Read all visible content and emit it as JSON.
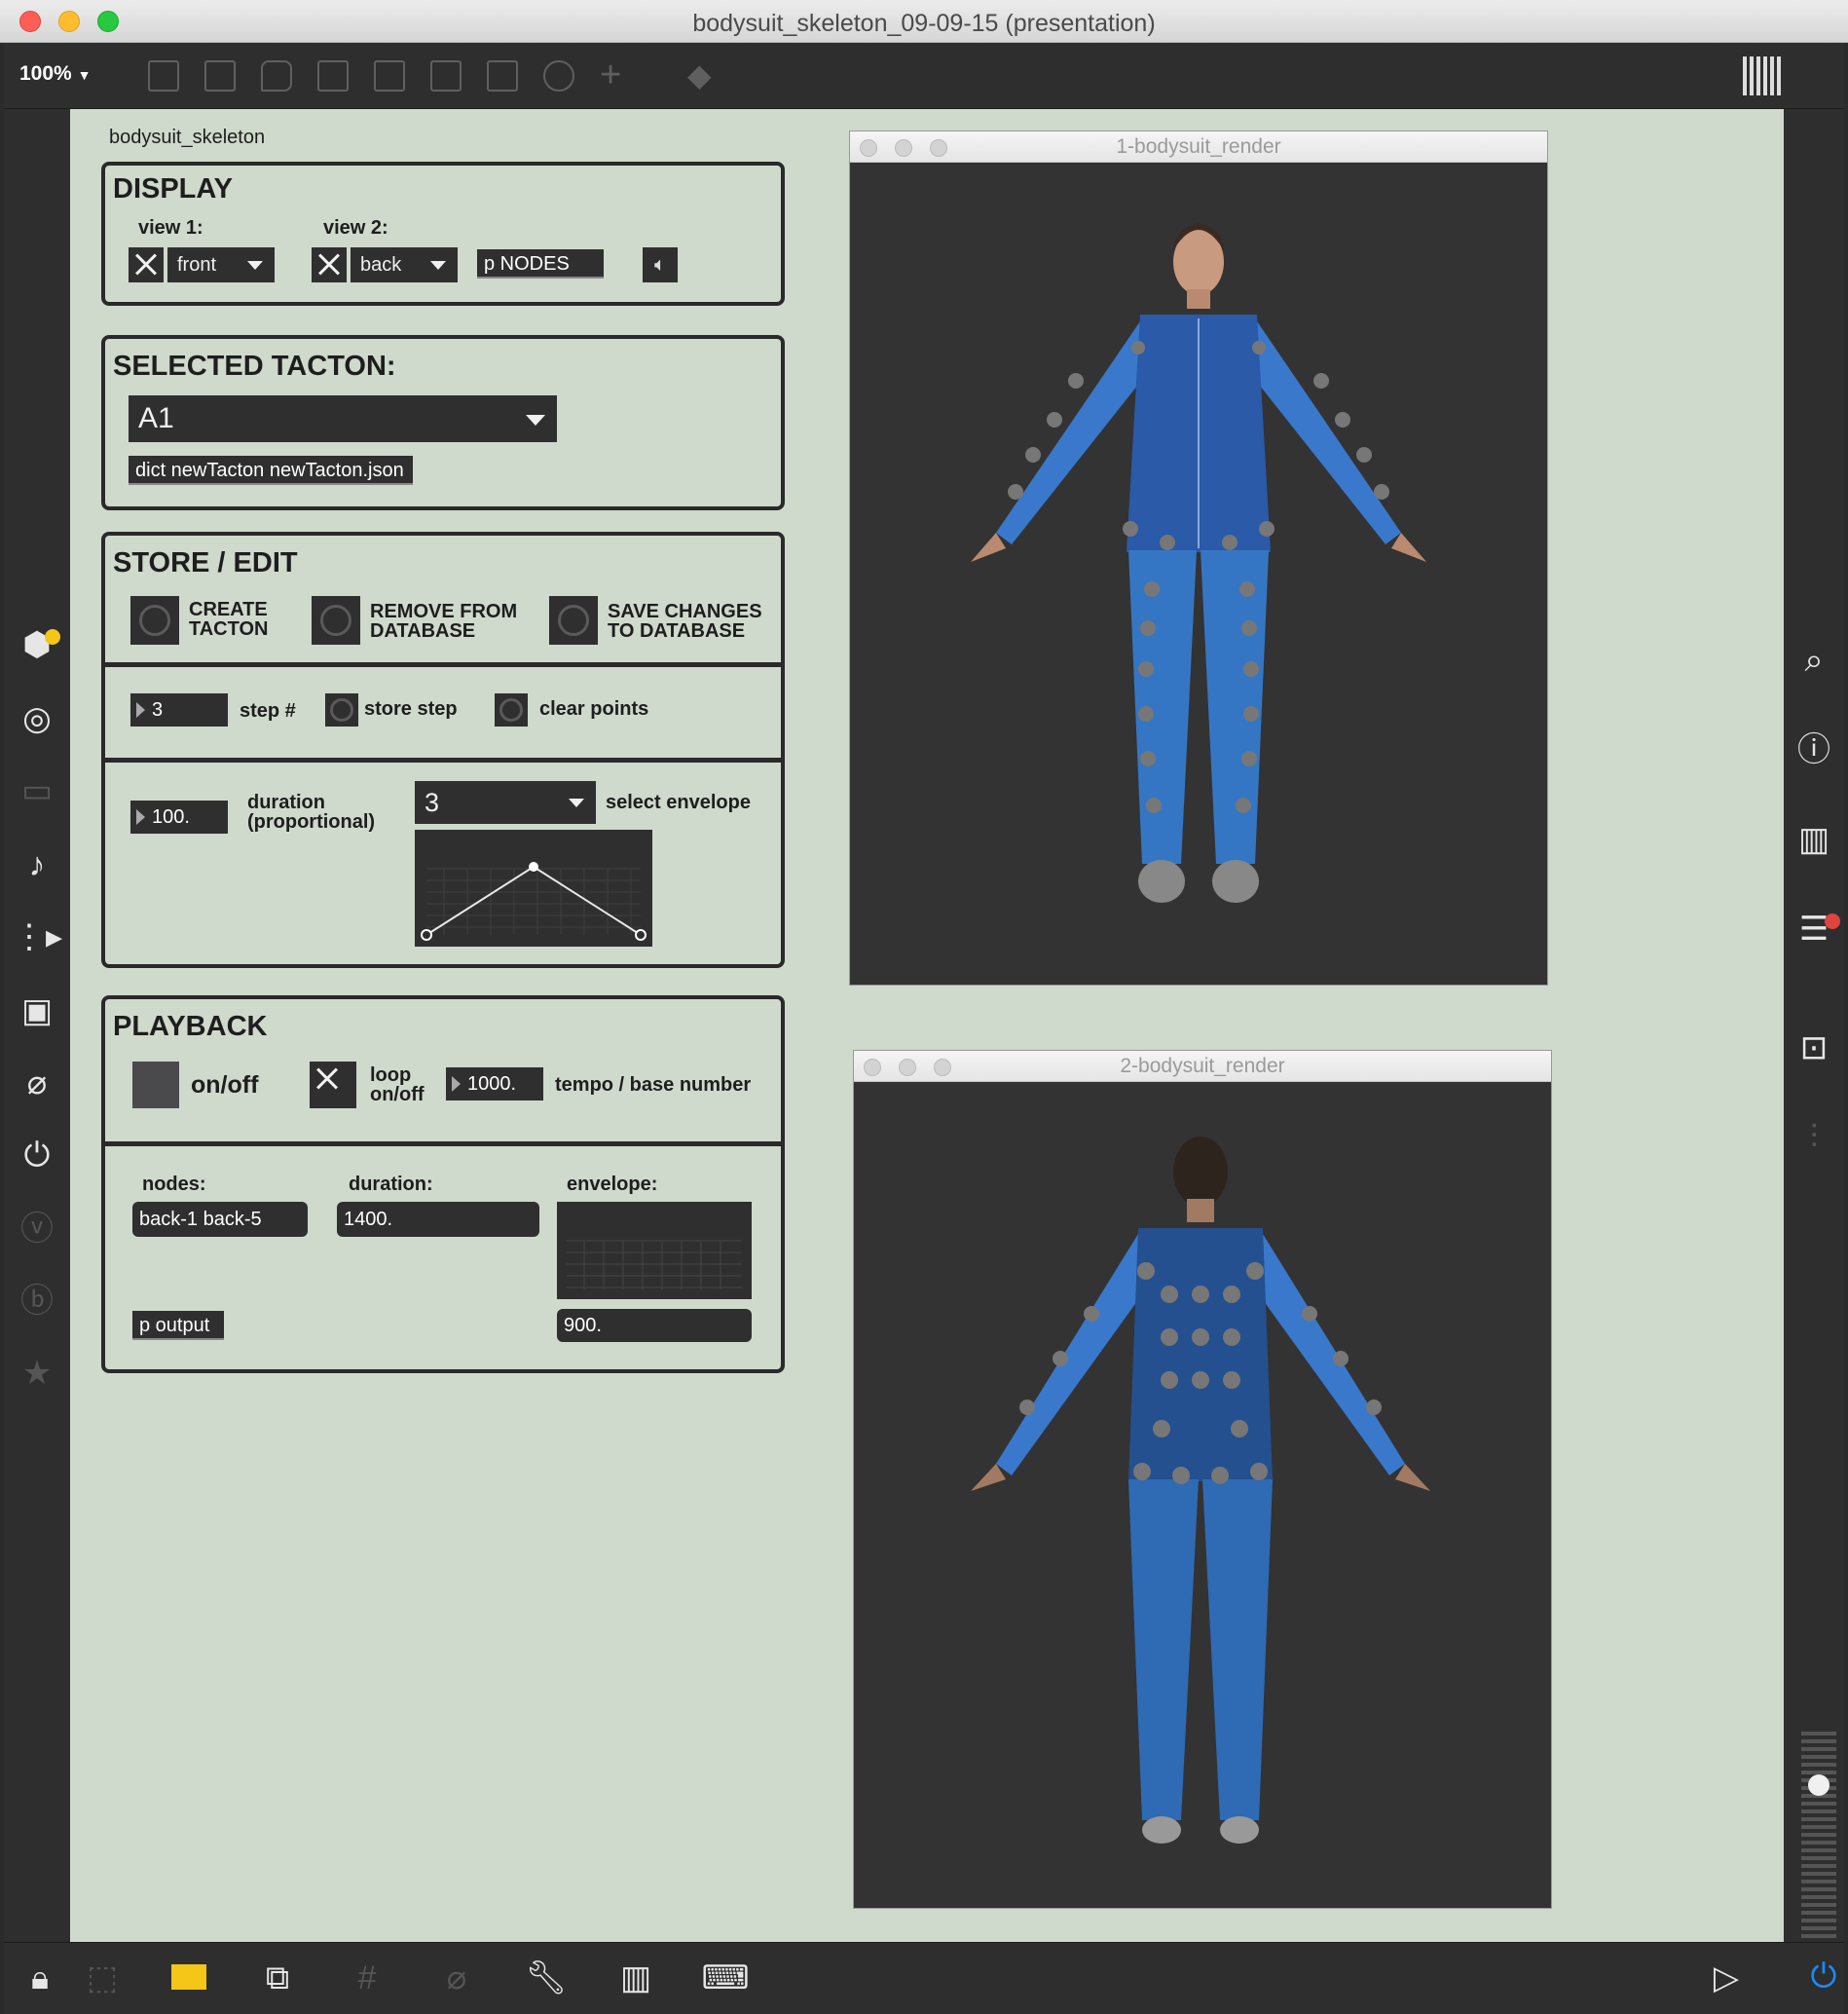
{
  "window": {
    "title": "bodysuit_skeleton_09-09-15 (presentation)"
  },
  "toolbar": {
    "zoom": "100%"
  },
  "patcher": {
    "name": "bodysuit_skeleton",
    "display": {
      "heading": "DISPLAY",
      "view1_label": "view 1:",
      "view1_value": "front",
      "view2_label": "view 2:",
      "view2_value": "back",
      "nodes_msg": "p NODES"
    },
    "selected": {
      "heading": "SELECTED TACTON:",
      "value": "A1",
      "dict_msg": "dict newTacton newTacton.json"
    },
    "store": {
      "heading": "STORE / EDIT",
      "create_label_1": "CREATE",
      "create_label_2": "TACTON",
      "remove_label_1": "REMOVE FROM",
      "remove_label_2": "DATABASE",
      "save_label_1": "SAVE CHANGES",
      "save_label_2": "TO DATABASE",
      "step_value": "3",
      "step_label": "step #",
      "store_step_label": "store step",
      "clear_points_label": "clear points",
      "duration_value": "100.",
      "duration_label_1": "duration",
      "duration_label_2": "(proportional)",
      "envelope_value": "3",
      "select_envelope_label": "select envelope"
    },
    "playback": {
      "heading": "PLAYBACK",
      "onoff_label": "on/off",
      "loop_label_1": "loop",
      "loop_label_2": "on/off",
      "tempo_value": "1000.",
      "tempo_label": "tempo / base number",
      "nodes_label": "nodes:",
      "nodes_value": "back-1 back-5",
      "duration_label": "duration:",
      "duration_value": "1400.",
      "envelope_label": "envelope:",
      "envelope_value": "900.",
      "output_msg": "p output"
    }
  },
  "render_windows": [
    {
      "title": "1-bodysuit_render"
    },
    {
      "title": "2-bodysuit_render"
    }
  ],
  "colors": {
    "canvas_bg": "#cfd9cc",
    "ui_dark": "#2f2f2f",
    "suit_blue": "#2f6fc0",
    "render_bg": "#333333"
  }
}
